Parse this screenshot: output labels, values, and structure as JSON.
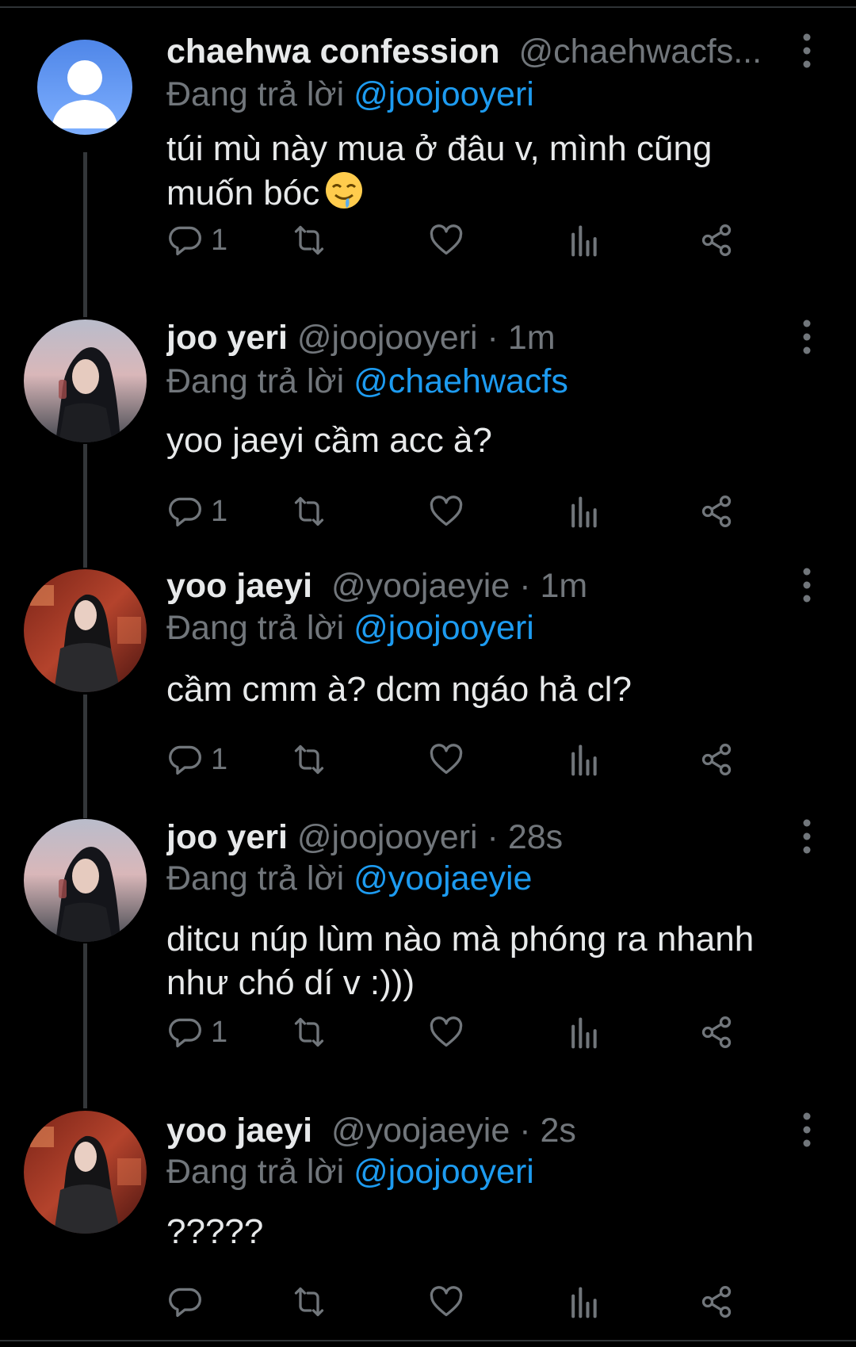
{
  "colors": {
    "background": "#000000",
    "text": "#e7e9ea",
    "muted": "#71767b",
    "mention": "#1d9bf0",
    "thread_line": "#333639"
  },
  "reply_prefix": "Đang trả lời",
  "tweets": [
    {
      "name": "chaehwa confession",
      "handle": "@chaehwacfs...",
      "dot": "",
      "time": "",
      "reply_to": "@joojooyeri",
      "text_lines": [
        "túi mù này mua ở đâu v, mình cũng",
        "muốn bóc"
      ],
      "emoji": "drooling-face-emoji",
      "avatar": "default-avatar",
      "replies": "1"
    },
    {
      "name": "joo yeri",
      "handle": "@joojooyeri",
      "dot": "·",
      "time": "1m",
      "reply_to": "@chaehwacfs",
      "text_lines": [
        "yoo jaeyi cầm acc à?"
      ],
      "avatar": "joo-yeri-avatar",
      "replies": "1"
    },
    {
      "name": "yoo jaeyi",
      "handle": "@yoojaeyie",
      "dot": "·",
      "time": "1m",
      "reply_to": "@joojooyeri",
      "text_lines": [
        "cầm cmm à? dcm ngáo hả cl?"
      ],
      "avatar": "yoo-jaeyi-avatar",
      "replies": "1"
    },
    {
      "name": "joo yeri",
      "handle": "@joojooyeri",
      "dot": "·",
      "time": "28s",
      "reply_to": "@yoojaeyie",
      "text_lines": [
        "ditcu núp lùm nào mà phóng ra nhanh",
        "như chó dí v :)))"
      ],
      "avatar": "joo-yeri-avatar",
      "replies": "1"
    },
    {
      "name": "yoo jaeyi",
      "handle": "@yoojaeyie",
      "dot": "·",
      "time": "2s",
      "reply_to": "@joojooyeri",
      "text_lines": [
        "?????"
      ],
      "avatar": "yoo-jaeyi-avatar",
      "replies": ""
    }
  ]
}
